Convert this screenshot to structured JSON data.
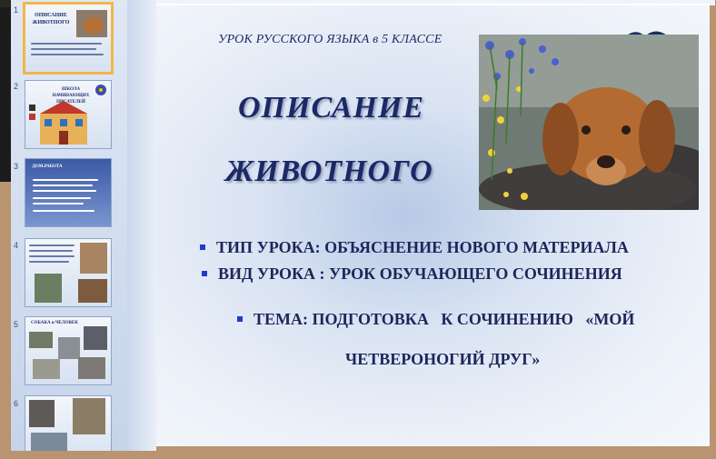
{
  "thumbnails": [
    {
      "number": "1",
      "title": "ОПИСАНИЕ ЖИВОТНОГО",
      "active": true
    },
    {
      "number": "2",
      "title": "ШКОЛА НАЧИНАЮЩИХ ПИСАТЕЛЕЙ",
      "active": false
    },
    {
      "number": "3",
      "title": "ДОМ.РАБОТА",
      "active": false
    },
    {
      "number": "4",
      "title": "",
      "active": false
    },
    {
      "number": "5",
      "title": "СОБАКА и ЧЕЛОВЕК",
      "active": false
    },
    {
      "number": "6",
      "title": "",
      "active": false
    }
  ],
  "slide": {
    "subtitle": "УРОК РУССКОГО ЯЗЫКА в 5 КЛАССЕ",
    "title_line1": "ОПИСАНИЕ",
    "title_line2": "ЖИВОТНОГО",
    "photo_icon": "dog-photo",
    "bullets": [
      "ТИП УРОКА: ОБЪЯСНЕНИЕ НОВОГО МАТЕРИАЛА",
      "ВИД УРОКА : УРОК ОБУЧАЮЩЕГО СОЧИНЕНИЯ",
      "ТЕМА: ПОДГОТОВКА   К СОЧИНЕНИЮ   «МОЙ",
      "ЧЕТВЕРОНОГИЙ ДРУГ»"
    ]
  },
  "colors": {
    "title": "#1b2966",
    "bullet_marker": "#1d3bd0",
    "active_thumb_border": "#f2b64a"
  }
}
